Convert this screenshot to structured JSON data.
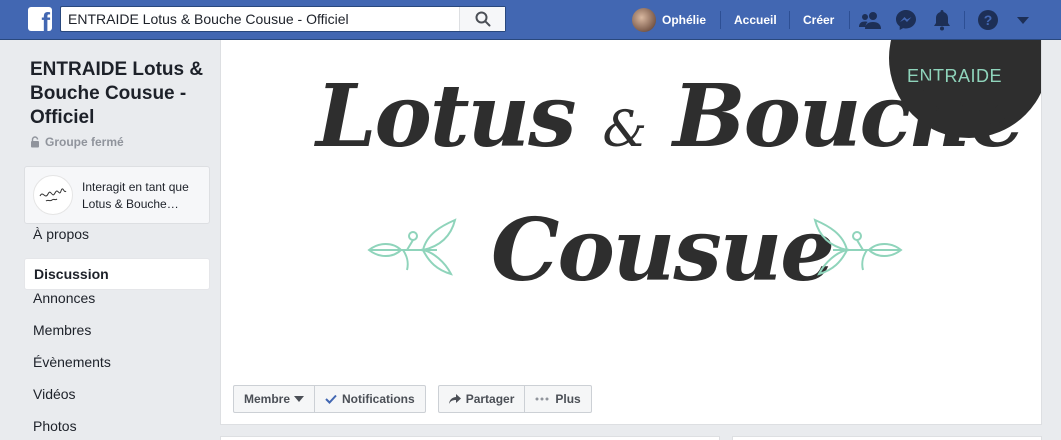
{
  "topbar": {
    "logo_letter": "f",
    "search_value": "ENTRAIDE Lotus & Bouche Cousue - Officiel",
    "user_name": "Ophélie",
    "home_label": "Accueil",
    "create_label": "Créer",
    "icons": [
      "friends-icon",
      "messenger-icon",
      "notifications-icon",
      "help-icon",
      "account-menu-icon"
    ]
  },
  "sidebar": {
    "group_title": "ENTRAIDE Lotus & Bouche Cousue - Officiel",
    "group_type": "Groupe fermé",
    "interact_text": "Interagit en tant que Lotus & Bouche…",
    "items": [
      {
        "label": "À propos"
      },
      {
        "label": "Discussion"
      },
      {
        "label": "Annonces"
      },
      {
        "label": "Membres"
      },
      {
        "label": "Évènements"
      },
      {
        "label": "Vidéos"
      },
      {
        "label": "Photos"
      }
    ],
    "active_item": "Discussion"
  },
  "cover": {
    "badge_text": "ENTRAIDE",
    "line1_a": "Lotus",
    "amp": "&",
    "line1_b": "Bouche",
    "line2": "Cousue",
    "accent_color": "#8fd4bb"
  },
  "actions": {
    "member_label": "Membre",
    "notifications_label": "Notifications",
    "share_label": "Partager",
    "more_label": "Plus"
  },
  "colors": {
    "brand": "#4267b2",
    "background": "#e9ebee",
    "check": "#4267b2"
  }
}
